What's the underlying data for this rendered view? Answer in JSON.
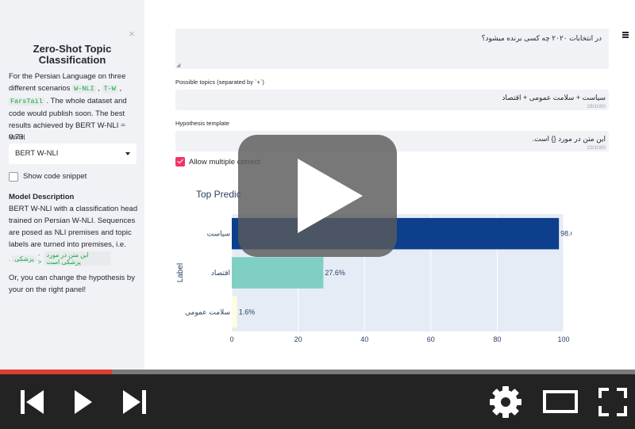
{
  "sidebar": {
    "close_glyph": "×",
    "title": "Zero-Shot Topic Classification",
    "intro": {
      "t1": "For the Persian Language on three different scenarios ",
      "c1": "W-NLI",
      "s1": " , ",
      "c2": "T-W",
      "s2": " , ",
      "c3": "FarsTail",
      "t2": " . The whole dataset and code would publish soon. The best results achieved by BERT W-NLI ",
      "eq": "= 0.73",
      "t3": "."
    },
    "model_label": "Model",
    "model_selected": "BERT W-NLI",
    "show_code_label": "Show code snippet",
    "desc_heading": "Model Description",
    "desc_text": "BERT W-NLI with a classification head trained on Persian W-NLI. Sequences are posed as NLI premises and topic labels are turned into premises, i.e.",
    "rtl_example": {
      "a": "پزشکی",
      "arrow": "->",
      "b": "این متن در مورد پزشکی است",
      "dot": "."
    },
    "footer": "Or, you can change the hypothesis by your on the right panel!"
  },
  "main": {
    "menu_icon": "hamburger-icon",
    "text_input_value": "در انتخابات ۲۰۲۰ چه کسی برنده میشود؟",
    "topics_label": "Possible topics (separated by `+`)",
    "topics_value": "سیاست + سلامت عمومی + اقتصاد",
    "topics_count": "28/1000",
    "hypothesis_label": "Hypothesis template",
    "hypothesis_value": "این متن در مورد {} است.",
    "hypothesis_count": "23/1000",
    "allow_multiple_label": "Allow multiple correct",
    "allow_multiple_checked": true
  },
  "chart_data": {
    "type": "bar",
    "orientation": "horizontal",
    "title": "Top Predic",
    "ylabel": "Label",
    "categories": [
      "سیاست",
      "اقتصاد",
      "سلامت عمومی"
    ],
    "values": [
      98.6,
      27.6,
      1.6
    ],
    "data_labels": [
      "98.6%",
      "27.6%",
      "1.6%"
    ],
    "colors": [
      "#0d3f8c",
      "#7fcfc4",
      "#fdfde0"
    ],
    "xlim": [
      0,
      100
    ],
    "xticks": [
      0,
      20,
      40,
      60,
      80,
      100
    ],
    "grid": true
  },
  "player": {
    "progress": 0.176,
    "accent": "#e03c31",
    "buttons": [
      "previous-icon",
      "play-icon",
      "next-icon",
      "settings-icon",
      "theater-mode-icon",
      "fullscreen-icon"
    ]
  }
}
